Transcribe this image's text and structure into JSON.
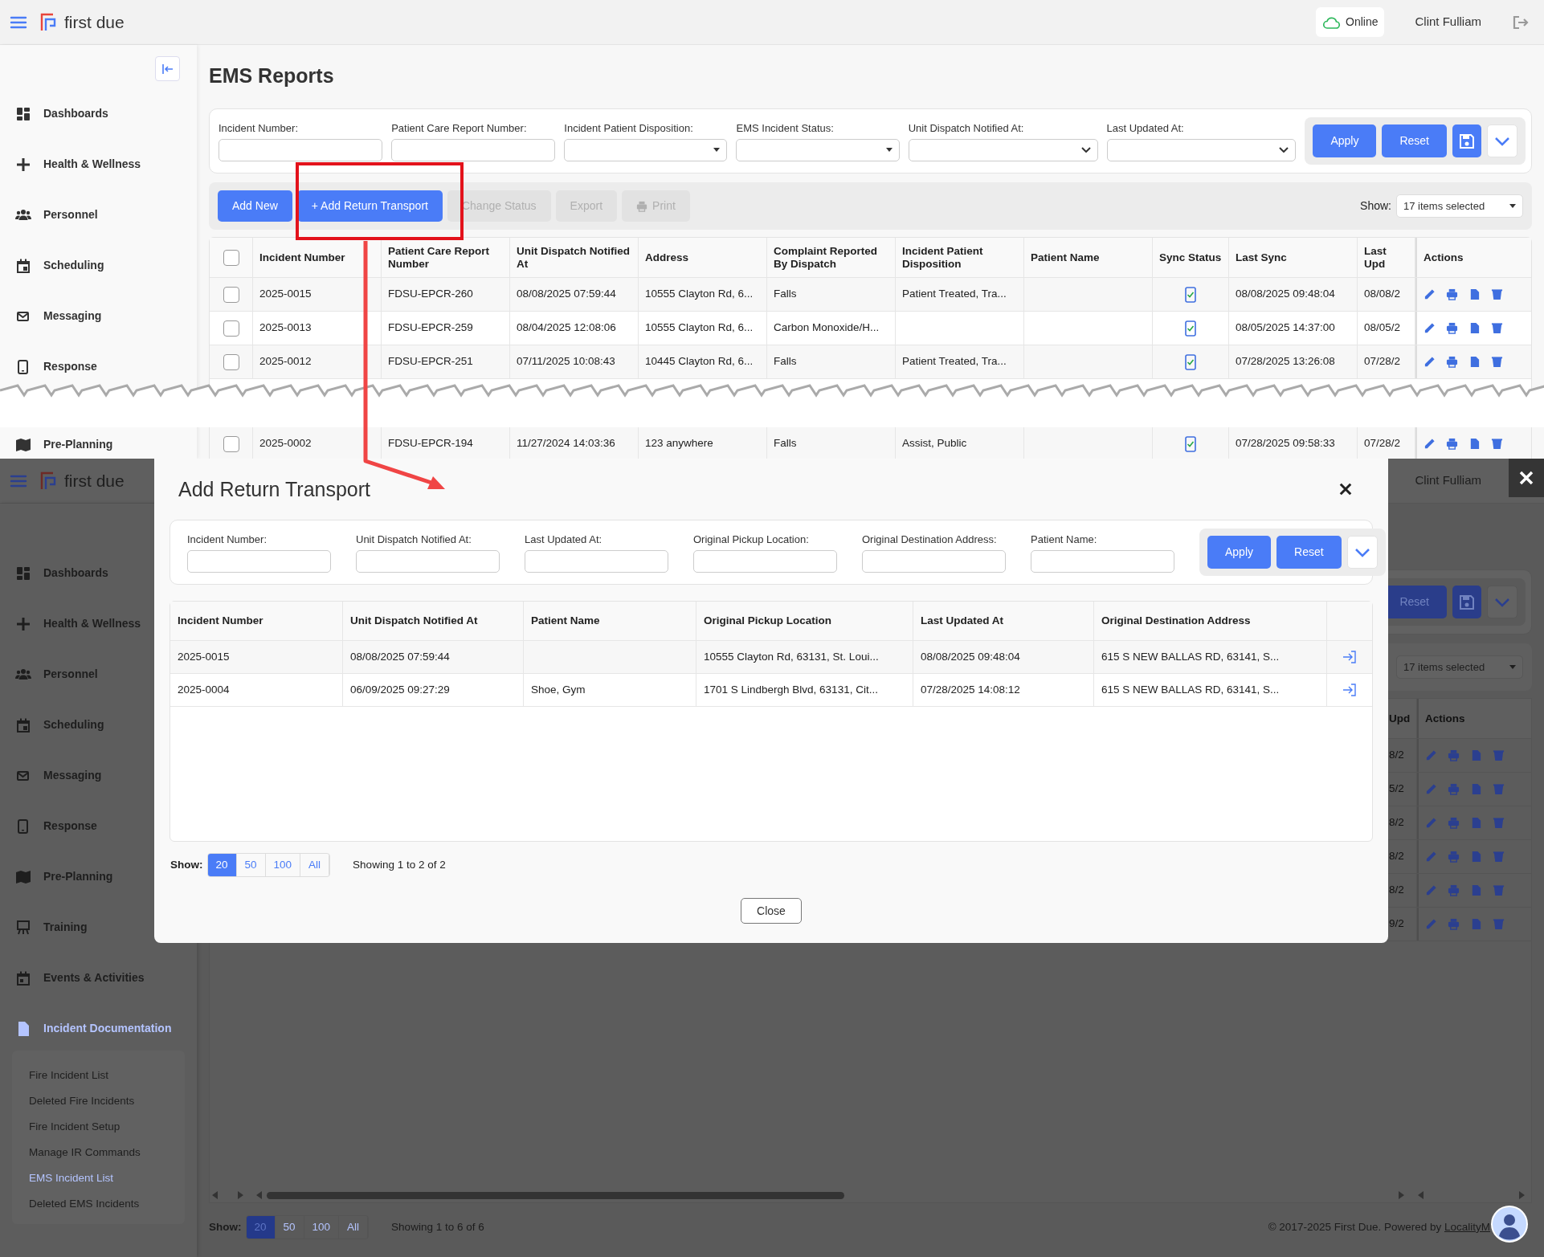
{
  "top_screen": {
    "header": {
      "logo_text": "first due",
      "connection": "Online",
      "user": "Clint Fulliam"
    },
    "sidebar": {
      "items": [
        {
          "label": "Dashboards"
        },
        {
          "label": "Health & Wellness"
        },
        {
          "label": "Personnel"
        },
        {
          "label": "Scheduling"
        },
        {
          "label": "Messaging"
        },
        {
          "label": "Response"
        },
        {
          "label": "Pre-Planning"
        }
      ]
    },
    "page_title": "EMS Reports",
    "filters": [
      {
        "label": "Incident Number:",
        "kind": "text"
      },
      {
        "label": "Patient Care Report Number:",
        "kind": "text"
      },
      {
        "label": "Incident Patient Disposition:",
        "kind": "dropdown"
      },
      {
        "label": "EMS Incident Status:",
        "kind": "dropdown"
      },
      {
        "label": "Unit Dispatch Notified At:",
        "kind": "select"
      },
      {
        "label": "Last Updated At:",
        "kind": "select"
      }
    ],
    "filter_buttons": [
      {
        "kind": "text",
        "label": "Apply"
      },
      {
        "kind": "text",
        "label": "Reset"
      },
      {
        "kind": "save"
      },
      {
        "kind": "expand"
      }
    ],
    "toolbar": [
      {
        "kind": "text",
        "label": "Add New",
        "disabled": false
      },
      {
        "kind": "text",
        "label": "+ Add Return Transport",
        "disabled": false
      },
      {
        "kind": "text",
        "label": "Change Status",
        "disabled": true
      },
      {
        "kind": "text",
        "label": "Export",
        "disabled": true
      },
      {
        "kind": "print",
        "label": "Print",
        "disabled": true
      }
    ],
    "show": {
      "label": "Show:",
      "value": "17 items selected"
    },
    "table": {
      "header_checked": false,
      "columns": [
        {
          "label": "Incident Number",
          "kind": "text"
        },
        {
          "label": "Patient Care Report Number",
          "kind": "text"
        },
        {
          "label": "Unit Dispatch Notified At",
          "kind": "text"
        },
        {
          "label": "Address",
          "kind": "text"
        },
        {
          "label": "Complaint Reported By Dispatch",
          "kind": "text"
        },
        {
          "label": "Incident Patient Disposition",
          "kind": "text"
        },
        {
          "label": "Patient Name",
          "kind": "text"
        },
        {
          "label": "Sync Status",
          "kind": "sync"
        },
        {
          "label": "Last Sync",
          "kind": "text"
        },
        {
          "label": "Last Upd",
          "kind": "text"
        },
        {
          "label": "Actions",
          "kind": "actions"
        }
      ],
      "rows": [
        {
          "checked": false,
          "synced": true,
          "cells": [
            "2025-0015",
            "FDSU-EPCR-260",
            "08/08/2025 07:59:44",
            "10555 Clayton Rd, 6...",
            "Falls",
            "Patient Treated, Tra...",
            "",
            "",
            "08/08/2025 09:48:04",
            "08/08/2",
            ""
          ]
        },
        {
          "checked": false,
          "synced": true,
          "cells": [
            "2025-0013",
            "FDSU-EPCR-259",
            "08/04/2025 12:08:06",
            "10555 Clayton Rd, 6...",
            "Carbon Monoxide/H...",
            "",
            "",
            "",
            "08/05/2025 14:37:00",
            "08/05/2",
            ""
          ]
        },
        {
          "checked": false,
          "synced": true,
          "cells": [
            "2025-0012",
            "FDSU-EPCR-251",
            "07/11/2025 10:08:43",
            "10445 Clayton Rd, 6...",
            "Falls",
            "Patient Treated, Tra...",
            "",
            "",
            "07/28/2025 13:26:08",
            "07/28/2",
            ""
          ]
        }
      ],
      "rows_after_tear": [
        {
          "checked": false,
          "synced": true,
          "cells": [
            "2025-0002",
            "FDSU-EPCR-194",
            "11/27/2024 14:03:36",
            "123 anywhere",
            "Falls",
            "Assist, Public",
            "",
            "",
            "07/28/2025 09:58:33",
            "07/28/2",
            ""
          ]
        }
      ]
    }
  },
  "bottom_screen": {
    "header": {
      "logo_text": "first due",
      "user": "Clint Fulliam"
    },
    "sidebar": {
      "items": [
        {
          "label": "Dashboards",
          "selected": false
        },
        {
          "label": "Health & Wellness",
          "selected": false
        },
        {
          "label": "Personnel",
          "selected": false
        },
        {
          "label": "Scheduling",
          "selected": false
        },
        {
          "label": "Messaging",
          "selected": false
        },
        {
          "label": "Response",
          "selected": false
        },
        {
          "label": "Pre-Planning",
          "selected": false
        },
        {
          "label": "Training",
          "selected": false
        },
        {
          "label": "Events & Activities",
          "selected": false
        },
        {
          "label": "Incident Documentation",
          "selected": true,
          "expanded": true,
          "children": [
            {
              "label": "Fire Incident List",
              "selected": false
            },
            {
              "label": "Deleted Fire Incidents",
              "selected": false
            },
            {
              "label": "Fire Incident Setup",
              "selected": false
            },
            {
              "label": "Manage IR Commands",
              "selected": false
            },
            {
              "label": "EMS Incident List",
              "selected": true
            },
            {
              "label": "Deleted EMS Incidents",
              "selected": false
            }
          ]
        }
      ]
    },
    "filter_buttons": [
      {
        "kind": "text",
        "label": "Reset"
      },
      {
        "kind": "save"
      },
      {
        "kind": "expand"
      }
    ],
    "show_value": "17 items selected",
    "table": {
      "columns": [
        "Upd",
        "Actions"
      ],
      "rows": [
        {
          "cells": [
            "8/2"
          ]
        },
        {
          "cells": [
            "5/2"
          ]
        },
        {
          "cells": [
            "8/2"
          ]
        },
        {
          "cells": [
            "8/2"
          ]
        },
        {
          "cells": [
            "8/2"
          ]
        },
        {
          "cells": [
            "9/2"
          ]
        }
      ]
    },
    "pagination": {
      "label": "Show:",
      "sizes": [
        {
          "label": "20",
          "selected": true
        },
        {
          "label": "50",
          "selected": false
        },
        {
          "label": "100",
          "selected": false
        },
        {
          "label": "All",
          "selected": false
        }
      ],
      "summary": "Showing 1 to 6 of 6"
    },
    "footer": {
      "text": "© 2017-2025 First Due. Powered by",
      "link": "LocalityM"
    },
    "dialog": {
      "title": "Add Return Transport",
      "filters": [
        "Incident Number:",
        "Unit Dispatch Notified At:",
        "Last Updated At:",
        "Original Pickup Location:",
        "Original Destination Address:",
        "Patient Name:"
      ],
      "buttons": [
        "Apply",
        "Reset"
      ],
      "table": {
        "columns": [
          "Incident Number",
          "Unit Dispatch Notified At",
          "Patient Name",
          "Original Pickup Location",
          "Last Updated At",
          "Original Destination Address"
        ],
        "rows": [
          {
            "cells": [
              "2025-0015",
              "08/08/2025 07:59:44",
              "",
              "10555 Clayton Rd, 63131, St. Loui...",
              "08/08/2025 09:48:04",
              "615 S NEW BALLAS RD, 63141, S..."
            ]
          },
          {
            "cells": [
              "2025-0004",
              "06/09/2025 09:27:29",
              "Shoe, Gym",
              "1701 S Lindbergh Blvd, 63131, Cit...",
              "07/28/2025 14:08:12",
              "615 S NEW BALLAS RD, 63141, S..."
            ]
          }
        ]
      },
      "pagination": {
        "label": "Show:",
        "sizes": [
          {
            "label": "20",
            "selected": true
          },
          {
            "label": "50",
            "selected": false
          },
          {
            "label": "100",
            "selected": false
          },
          {
            "label": "All",
            "selected": false
          }
        ],
        "summary": "Showing 1 to 2 of 2"
      },
      "close_button": "Close"
    }
  }
}
